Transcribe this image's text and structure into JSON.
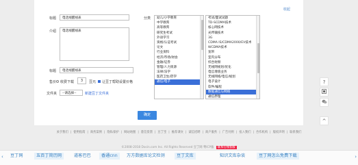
{
  "corner_link": "收起",
  "form": {
    "title_label": "标题",
    "title_value": "电话线醒线表",
    "intro_label": "介绍",
    "intro_value": "电话线醒线表",
    "title2_label": "标题",
    "title2_value": "电话线醒线表",
    "price_label": "售价",
    "price_prefix": "收费下载",
    "price_value": "3",
    "price_unit": "豆元",
    "price_check_text": "让豆丁帮助设置价格",
    "folder_label": "文件夹",
    "folder_value": "--请选择--",
    "new_folder_link": "新建豆丁文件夹",
    "category_label": "分类"
  },
  "category_list": {
    "items": [
      "幼儿/小学教育",
      "中学教育",
      "高等教育",
      "研究生考试",
      "外语学习",
      "资格/认证考试",
      "论文",
      "行业资料",
      "经济/市场/财会",
      "金融/证券",
      "管理/人力资源",
      "法律/法学",
      "医药卫生/药学",
      "通信/电子"
    ],
    "selected_index": 13
  },
  "subcategory_list": {
    "items": [
      "考试/面试试题",
      "TD-SCDMA技术",
      "核心网技术",
      "光传输技术",
      "3G",
      "CDMA IS/CDMA2000/EV技术",
      "WCDMA技术",
      "宽带",
      "室内分布",
      "综合射频",
      "无线网规划/优化",
      "电信增值业务",
      "无线网络/电信/规划",
      "电子设计",
      "软件/编程",
      "数据通信与网络",
      "通信原理"
    ],
    "selected_index": 15
  },
  "ok_button": "确定",
  "footer": {
    "links": [
      "关于我们",
      "使用指南",
      "商务案例",
      "隐私保护",
      "网站地图",
      "意见反馈",
      "豆丁宝",
      "推荐课文",
      "诚信招聘",
      "商户服务",
      "广告刊例",
      "投入我们",
      "合作机构",
      "版权声明",
      "联系我们"
    ],
    "copyright": "©2008-2018 Docin.com Inc. All Rights Reserved 豆丁网 粤ICP备",
    "badge": "联系在线客服"
  },
  "bottom_tabs": [
    "豆丁网",
    "五百丁简历网",
    "道客巴巴",
    "香通cnn",
    "万方数据库论文检测",
    "豆丁文库",
    "知识文库杂谈",
    "豆丁网怎么免费下载"
  ],
  "side_icons": [
    "?",
    "",
    "",
    "^"
  ]
}
